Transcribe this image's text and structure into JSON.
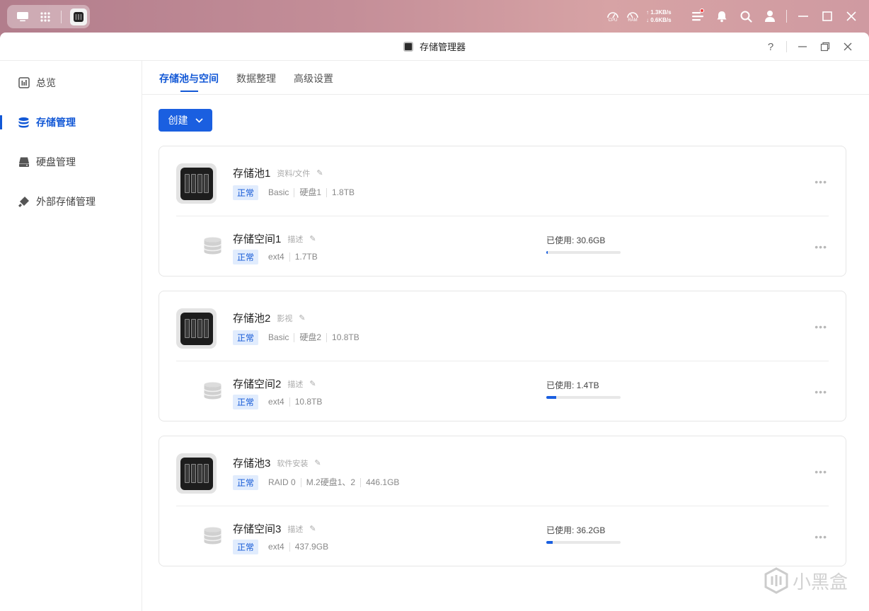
{
  "topbar": {
    "cpu_label": "CPU",
    "ram_label": "RAM",
    "upload": "↑ 1.3KB/s",
    "download": "↓ 0.6KB/s",
    "has_notification": true
  },
  "window": {
    "title": "存储管理器",
    "help": "?"
  },
  "sidebar": {
    "items": [
      {
        "label": "总览",
        "icon": "chart-icon",
        "active": false
      },
      {
        "label": "存储管理",
        "icon": "database-icon",
        "active": true
      },
      {
        "label": "硬盘管理",
        "icon": "drive-icon",
        "active": false
      },
      {
        "label": "外部存储管理",
        "icon": "usb-icon",
        "active": false
      }
    ]
  },
  "tabs": [
    {
      "label": "存储池与空间",
      "active": true
    },
    {
      "label": "数据整理",
      "active": false
    },
    {
      "label": "高级设置",
      "active": false
    }
  ],
  "create_button": "创建",
  "pools": [
    {
      "name": "存储池1",
      "desc": "资料/文件",
      "status": "正常",
      "meta": [
        "Basic",
        "硬盘1",
        "1.8TB"
      ],
      "volume": {
        "name": "存储空间1",
        "desc": "描述",
        "status": "正常",
        "meta": [
          "ext4",
          "1.7TB"
        ],
        "used": "已使用: 30.6GB",
        "used_fraction": 0.018
      }
    },
    {
      "name": "存储池2",
      "desc": "影视",
      "status": "正常",
      "meta": [
        "Basic",
        "硬盘2",
        "10.8TB"
      ],
      "volume": {
        "name": "存储空间2",
        "desc": "描述",
        "status": "正常",
        "meta": [
          "ext4",
          "10.8TB"
        ],
        "used": "已使用: 1.4TB",
        "used_fraction": 0.13
      }
    },
    {
      "name": "存储池3",
      "desc": "软件安装",
      "status": "正常",
      "meta": [
        "RAID 0",
        "M.2硬盘1、2",
        "446.1GB"
      ],
      "volume": {
        "name": "存储空间3",
        "desc": "描述",
        "status": "正常",
        "meta": [
          "ext4",
          "437.9GB"
        ],
        "used": "已使用: 36.2GB",
        "used_fraction": 0.083
      }
    }
  ],
  "colors": {
    "accent": "#1a5fe0",
    "badge_bg": "#e1ecfd"
  }
}
